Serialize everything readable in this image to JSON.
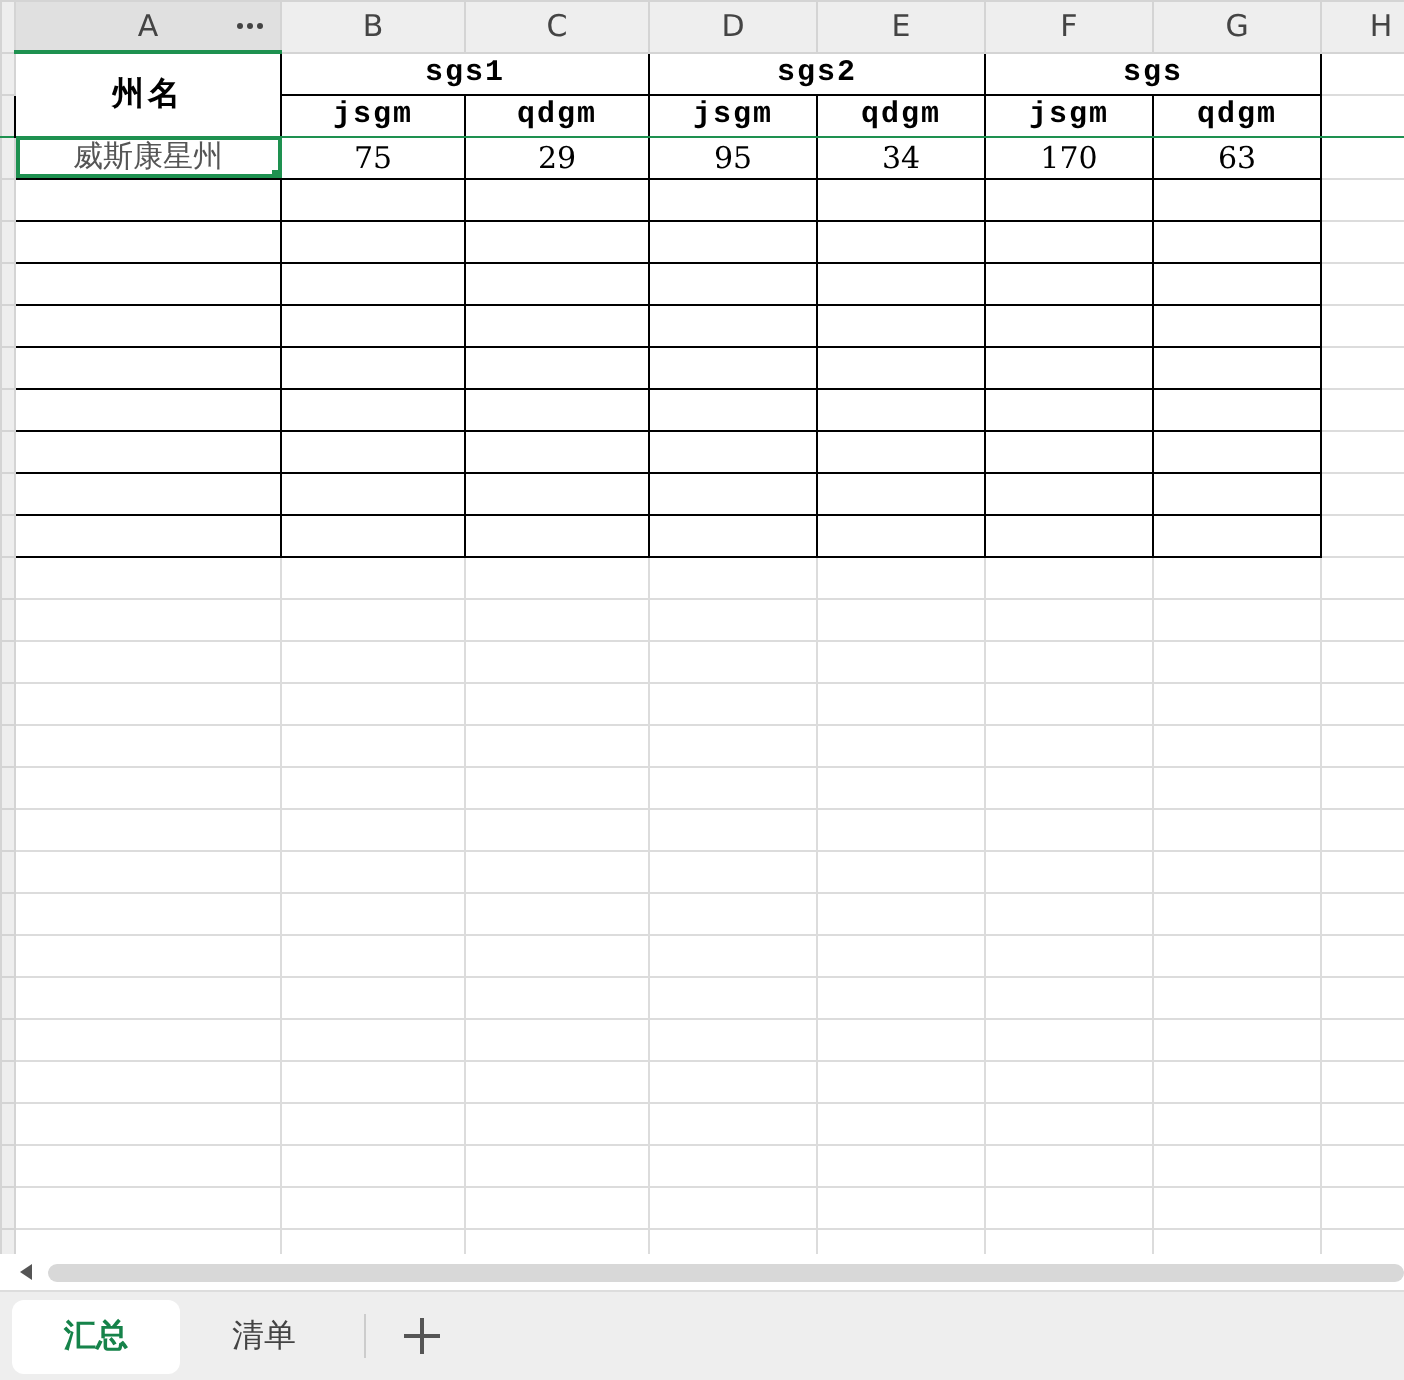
{
  "columns": [
    {
      "label": "A",
      "selected": true
    },
    {
      "label": "B",
      "selected": false
    },
    {
      "label": "C",
      "selected": false
    },
    {
      "label": "D",
      "selected": false
    },
    {
      "label": "E",
      "selected": false
    },
    {
      "label": "F",
      "selected": false
    },
    {
      "label": "G",
      "selected": false
    },
    {
      "label": "H",
      "selected": false
    }
  ],
  "header": {
    "first": "州名",
    "groups": [
      {
        "label": "sgs1",
        "subheaders": [
          "jsgm",
          "qdgm"
        ]
      },
      {
        "label": "sgs2",
        "subheaders": [
          "jsgm",
          "qdgm"
        ]
      },
      {
        "label": "sgs",
        "subheaders": [
          "jsgm",
          "qdgm"
        ]
      }
    ]
  },
  "rows": [
    {
      "name": {
        "text": "威斯康星州",
        "selected": true
      },
      "values": [
        "75",
        "29",
        "95",
        "34",
        "170",
        "63"
      ]
    }
  ],
  "sheet_tabs": [
    {
      "label": "汇总",
      "selected": true
    },
    {
      "label": "清单",
      "selected": false
    }
  ]
}
